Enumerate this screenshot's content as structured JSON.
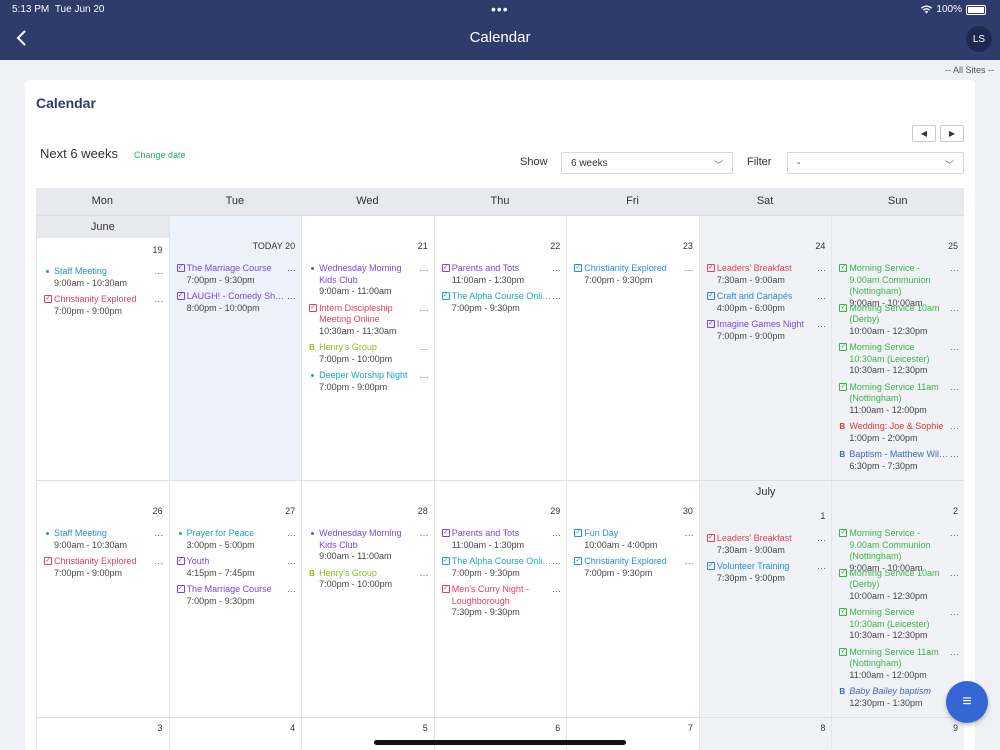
{
  "status_bar": {
    "time": "5:13 PM",
    "date": "Tue Jun 20",
    "battery": "100%"
  },
  "nav": {
    "title": "Calendar",
    "avatar_initials": "LS"
  },
  "all_sites": "-- All Sites --",
  "card": {
    "title": "Calendar",
    "period": "Next 6 weeks",
    "change_date": "Change date",
    "show_label": "Show",
    "show_value": "6 weeks",
    "filter_label": "Filter",
    "filter_value": "-"
  },
  "days_of_week": [
    "Mon",
    "Tue",
    "Wed",
    "Thu",
    "Fri",
    "Sat",
    "Sun"
  ],
  "weeks": [
    {
      "days": [
        {
          "num": "19",
          "month": "June",
          "events": [
            {
              "icon": "dot",
              "color": "blue",
              "title": "Staff Meeting",
              "time": "9:00am - 10:30am"
            },
            {
              "icon": "box",
              "color": "red",
              "title": "Christianity Explored",
              "time": "7:00pm - 9:00pm"
            }
          ]
        },
        {
          "num": "TODAY 20",
          "today": true,
          "events": [
            {
              "icon": "box",
              "color": "purple",
              "title": "The Marriage Course",
              "time": "7:00pm - 9:30pm"
            },
            {
              "icon": "box",
              "color": "purple",
              "title": "LAUGH! - Comedy Show...",
              "time": "8:00pm - 10:00pm",
              "nowrap": true
            }
          ]
        },
        {
          "num": "21",
          "events": [
            {
              "icon": "dot",
              "color": "purple",
              "title": "Wednesday Morning Kids Club",
              "time": "9:00am - 11:00am"
            },
            {
              "icon": "box",
              "color": "red",
              "title": "Intern Discipleship Meeting Online",
              "time": "10:30am - 11:30am"
            },
            {
              "icon": "b",
              "color": "olive",
              "title": "Henry's Group",
              "time": "7:00pm - 10:00pm"
            },
            {
              "icon": "dot",
              "color": "teal",
              "title": "Deeper Worship Night",
              "time": "7:00pm - 9:00pm"
            }
          ]
        },
        {
          "num": "22",
          "events": [
            {
              "icon": "box",
              "color": "purple",
              "title": "Parents and Tots",
              "time": "11:00am - 1:30pm"
            },
            {
              "icon": "box",
              "color": "teal",
              "title": "The Alpha Course Online...",
              "time": "7:00pm - 9:30pm",
              "nowrap": true
            }
          ]
        },
        {
          "num": "23",
          "events": [
            {
              "icon": "box",
              "color": "blue",
              "title": "Christianity Explored",
              "time": "7:00pm - 9:30pm"
            }
          ]
        },
        {
          "num": "24",
          "events": [
            {
              "icon": "box",
              "color": "red",
              "title": "Leaders' Breakfast",
              "time": "7:30am - 9:00am"
            },
            {
              "icon": "box",
              "color": "blue",
              "title": "Craft and Canapés",
              "time": "4:00pm - 6:00pm"
            },
            {
              "icon": "box",
              "color": "purple",
              "title": "Imagine Games Night",
              "time": "7:00pm - 9:00pm"
            }
          ]
        },
        {
          "num": "25",
          "events": [
            {
              "icon": "box",
              "color": "green",
              "title": "Morning Service - 9.00am Communion (Nottingham)",
              "time": "9:00am - 10:00am"
            },
            {
              "icon": "box",
              "color": "green",
              "title": "Morning Service 10am (Derby)",
              "time": "10:00am - 12:30pm"
            },
            {
              "icon": "box",
              "color": "green",
              "title": "Morning Service 10:30am (Leicester)",
              "time": "10:30am - 12:30pm"
            },
            {
              "icon": "box",
              "color": "green",
              "title": "Morning Service 11am (Nottingham)",
              "time": "11:00am - 12:00pm"
            },
            {
              "icon": "b",
              "color": "crimson",
              "title": "Wedding: Joe & Sophie",
              "time": "1:00pm - 2:00pm"
            },
            {
              "icon": "b",
              "color": "navy",
              "title": "Baptism - Matthew Wilson",
              "time": "6:30pm - 7:30pm",
              "nowrap": true
            }
          ]
        }
      ]
    },
    {
      "days": [
        {
          "num": "26",
          "events": [
            {
              "icon": "dot",
              "color": "blue",
              "title": "Staff Meeting",
              "time": "9:00am - 10:30am"
            },
            {
              "icon": "box",
              "color": "red",
              "title": "Christianity Explored",
              "time": "7:00pm - 9:00pm"
            }
          ]
        },
        {
          "num": "27",
          "events": [
            {
              "icon": "dot",
              "color": "teal",
              "title": "Prayer for Peace",
              "time": "3:00pm - 5:00pm"
            },
            {
              "icon": "box",
              "color": "purple",
              "title": "Youth",
              "time": "4:15pm - 7:45pm"
            },
            {
              "icon": "box",
              "color": "purple",
              "title": "The Marriage Course",
              "time": "7:00pm - 9:30pm"
            }
          ]
        },
        {
          "num": "28",
          "events": [
            {
              "icon": "dot",
              "color": "purple",
              "title": "Wednesday Morning Kids Club",
              "time": "9:00am - 11:00am"
            },
            {
              "icon": "b",
              "color": "olive",
              "title": "Henry's Group",
              "time": "7:00pm - 10:00pm"
            }
          ]
        },
        {
          "num": "29",
          "events": [
            {
              "icon": "box",
              "color": "purple",
              "title": "Parents and Tots",
              "time": "11:00am - 1:30pm"
            },
            {
              "icon": "box",
              "color": "teal",
              "title": "The Alpha Course Online...",
              "time": "7:00pm - 9:30pm",
              "nowrap": true
            },
            {
              "icon": "box",
              "color": "red",
              "title": "Men's Curry Night - Loughborough",
              "time": "7:30pm - 9:30pm"
            }
          ]
        },
        {
          "num": "30",
          "events": [
            {
              "icon": "box",
              "color": "blue",
              "title": "Fun Day",
              "time": "10:00am - 4:00pm"
            },
            {
              "icon": "box",
              "color": "blue",
              "title": "Christianity Explored",
              "time": "7:00pm - 9:30pm"
            }
          ]
        },
        {
          "num": "1",
          "month": "July",
          "events": [
            {
              "icon": "box",
              "color": "red",
              "title": "Leaders' Breakfast",
              "time": "7:30am - 9:00am"
            },
            {
              "icon": "box",
              "color": "blue",
              "title": "Volunteer Training",
              "time": "7:30pm - 9:00pm"
            }
          ]
        },
        {
          "num": "2",
          "events": [
            {
              "icon": "box",
              "color": "green",
              "title": "Morning Service - 9.00am Communion (Nottingham)",
              "time": "9:00am - 10:00am"
            },
            {
              "icon": "box",
              "color": "green",
              "title": "Morning Service 10am (Derby)",
              "time": "10:00am - 12:30pm"
            },
            {
              "icon": "box",
              "color": "green",
              "title": "Morning Service 10:30am (Leicester)",
              "time": "10:30am - 12:30pm"
            },
            {
              "icon": "box",
              "color": "green",
              "title": "Morning Service 11am (Nottingham)",
              "time": "11:00am - 12:00pm"
            },
            {
              "icon": "b",
              "color": "navy",
              "title": "Baby Bailey baptism",
              "time": "12:30pm - 1:30pm",
              "italic": true
            }
          ]
        }
      ]
    },
    {
      "days": [
        {
          "num": "3",
          "events": []
        },
        {
          "num": "4",
          "events": []
        },
        {
          "num": "5",
          "events": []
        },
        {
          "num": "6",
          "events": []
        },
        {
          "num": "7",
          "events": []
        },
        {
          "num": "8",
          "events": []
        },
        {
          "num": "9",
          "events": []
        }
      ]
    }
  ],
  "colors": {
    "header_bg": "#2f3b6b",
    "fab_bg": "#3466d6",
    "blue": "#2b8dd6",
    "red": "#e0415c",
    "purple": "#7a45e0",
    "green": "#3ab54a",
    "olive": "#8dbd1c",
    "teal": "#1aa6b7",
    "navy": "#3b66c9",
    "crimson": "#d33a3a"
  },
  "icons": {
    "back": "chevron-left-icon",
    "prev": "caret-left-icon",
    "next": "caret-right-icon",
    "fab": "menu-icon",
    "wifi": "wifi-icon",
    "battery": "battery-icon"
  }
}
